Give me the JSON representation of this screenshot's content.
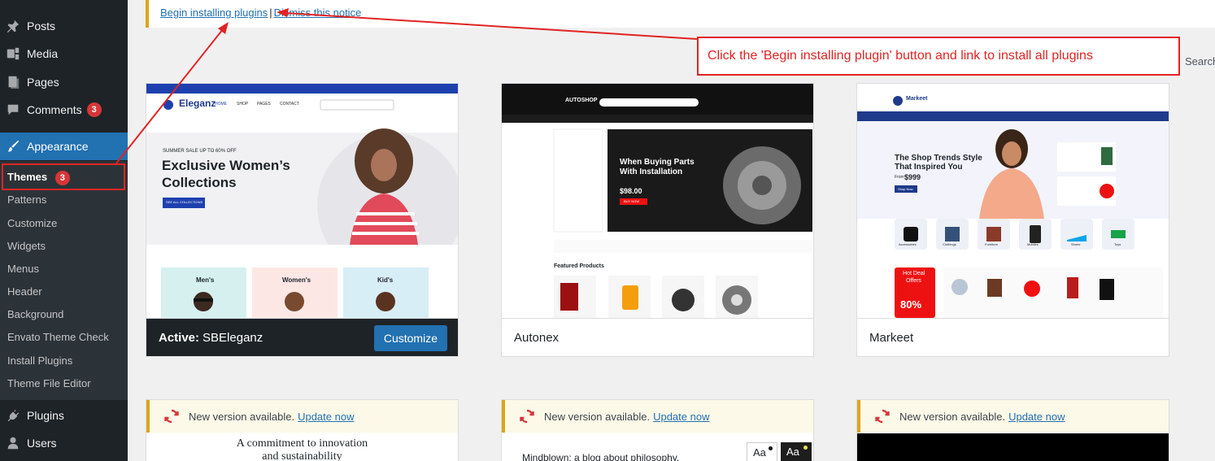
{
  "sidebar": {
    "menu": [
      {
        "label": "Posts",
        "icon": "pushpin-icon"
      },
      {
        "label": "Media",
        "icon": "media-icon"
      },
      {
        "label": "Pages",
        "icon": "pages-icon"
      },
      {
        "label": "Comments",
        "icon": "comments-icon",
        "badge": "3"
      },
      {
        "label": "Appearance",
        "icon": "paintbrush-icon"
      },
      {
        "label": "Plugins",
        "icon": "plugin-icon"
      },
      {
        "label": "Users",
        "icon": "users-icon"
      }
    ],
    "submenu": [
      {
        "label": "Themes",
        "badge": "3"
      },
      {
        "label": "Patterns"
      },
      {
        "label": "Customize"
      },
      {
        "label": "Widgets"
      },
      {
        "label": "Menus"
      },
      {
        "label": "Header"
      },
      {
        "label": "Background"
      },
      {
        "label": "Envato Theme Check"
      },
      {
        "label": "Install Plugins"
      },
      {
        "label": "Theme File Editor"
      }
    ]
  },
  "notice": {
    "begin_link": "Begin installing plugins",
    "separator": "|",
    "dismiss_link": "Dismiss this notice"
  },
  "callout": {
    "text": "Click the 'Begin installing plugin' button and link to install all plugins"
  },
  "search_label": "Search",
  "themes": [
    {
      "name": "SBEleganz",
      "active_label": "Active:",
      "customize_label": "Customize",
      "preview": {
        "brand": "Eleganz",
        "nav": [
          "HOME",
          "SHOP",
          "PAGES",
          "CONTACT"
        ],
        "sale": "SUMMER SALE UP TO 60% OFF",
        "headline_1": "Exclusive Women’s",
        "headline_2": "Collections",
        "cta": "SEE ALL COLLECTIONS",
        "categories": [
          "Men's",
          "Women's",
          "Kid's"
        ]
      }
    },
    {
      "name": "Autonex",
      "preview": {
        "brand": "AUTOSHOP",
        "headline_1": "When Buying Parts",
        "headline_2": "With Installation",
        "price": "$98.00",
        "cta": "BUY NOW",
        "featured": "Featured Products"
      }
    },
    {
      "name": "Markeet",
      "preview": {
        "brand": "Markeet",
        "headline_1": "The Shop Trends Style",
        "headline_2": "That Inspired You",
        "price_label": "From",
        "price": "$999",
        "cta": "Shop Now",
        "deal_1": "Hot Deal",
        "deal_2": "Offers",
        "deal_pct": "80%",
        "categories": [
          "Accessories",
          "Clothings",
          "Furniture",
          "Mobiles",
          "Shoes",
          "Toys"
        ]
      }
    }
  ],
  "updates": [
    {
      "text": "New version available.",
      "link": "Update now",
      "preview_1": "A commitment to innovation",
      "preview_2": "and sustainability"
    },
    {
      "text": "New version available.",
      "link": "Update now",
      "preview_1": "Mindblown: a blog about philosophy.",
      "aa": "Aa"
    },
    {
      "text": "New version available.",
      "link": "Update now"
    }
  ]
}
